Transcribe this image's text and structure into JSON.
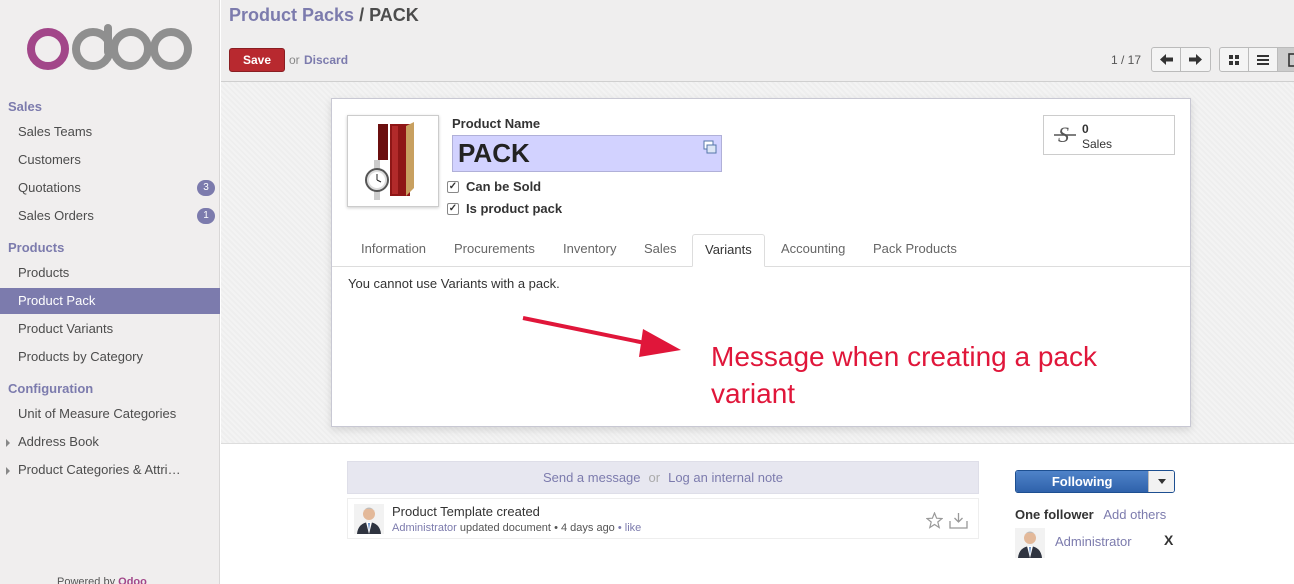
{
  "sidebar": {
    "logo_text": "odoo",
    "sections": [
      {
        "title": "Sales",
        "items": [
          {
            "label": "Sales Teams",
            "badge": ""
          },
          {
            "label": "Customers",
            "badge": ""
          },
          {
            "label": "Quotations",
            "badge": "3"
          },
          {
            "label": "Sales Orders",
            "badge": "1"
          }
        ]
      },
      {
        "title": "Products",
        "items": [
          {
            "label": "Products",
            "badge": ""
          },
          {
            "label": "Product Pack",
            "badge": ""
          },
          {
            "label": "Product Variants",
            "badge": ""
          },
          {
            "label": "Products by Category",
            "badge": ""
          }
        ]
      },
      {
        "title": "Configuration",
        "items": [
          {
            "label": "Unit of Measure Categories"
          },
          {
            "label": "Address Book"
          },
          {
            "label": "Product Categories & Attri…"
          }
        ]
      }
    ],
    "powered_by": "Powered by",
    "powered_brand": "Odoo"
  },
  "header": {
    "breadcrumb_parent": "Product Packs",
    "breadcrumb_sep": "/",
    "breadcrumb_current": "PACK",
    "save_label": "Save",
    "or_label": "or",
    "discard_label": "Discard",
    "pager": "1 / 17"
  },
  "form": {
    "product_name_label": "Product Name",
    "product_name_value": "PACK",
    "can_be_sold_label": "Can be Sold",
    "is_pack_label": "Is product pack",
    "stat_sales_value": "0",
    "stat_sales_label": "Sales",
    "tabs": [
      "Information",
      "Procurements",
      "Inventory",
      "Sales",
      "Variants",
      "Accounting",
      "Pack Products"
    ],
    "active_tab": "Variants",
    "tab_message": "You cannot use Variants with a pack."
  },
  "annotation": {
    "text": "Message when creating a pack variant",
    "color": "#e0163a"
  },
  "chatter": {
    "send_message": "Send a message",
    "or_label": "or",
    "log_note": "Log an internal note",
    "message_title": "Product Template created",
    "message_author": "Administrator",
    "message_action": "updated document",
    "message_time": "4 days ago",
    "message_like": "like",
    "following_label": "Following",
    "followers_count": "One follower",
    "add_others": "Add others",
    "follower_name": "Administrator",
    "remove_glyph": "X"
  },
  "colors": {
    "accent": "#7c7bad",
    "save": "#b8292f",
    "following": "#3a6db5",
    "name_bg": "#d2d2ff"
  }
}
